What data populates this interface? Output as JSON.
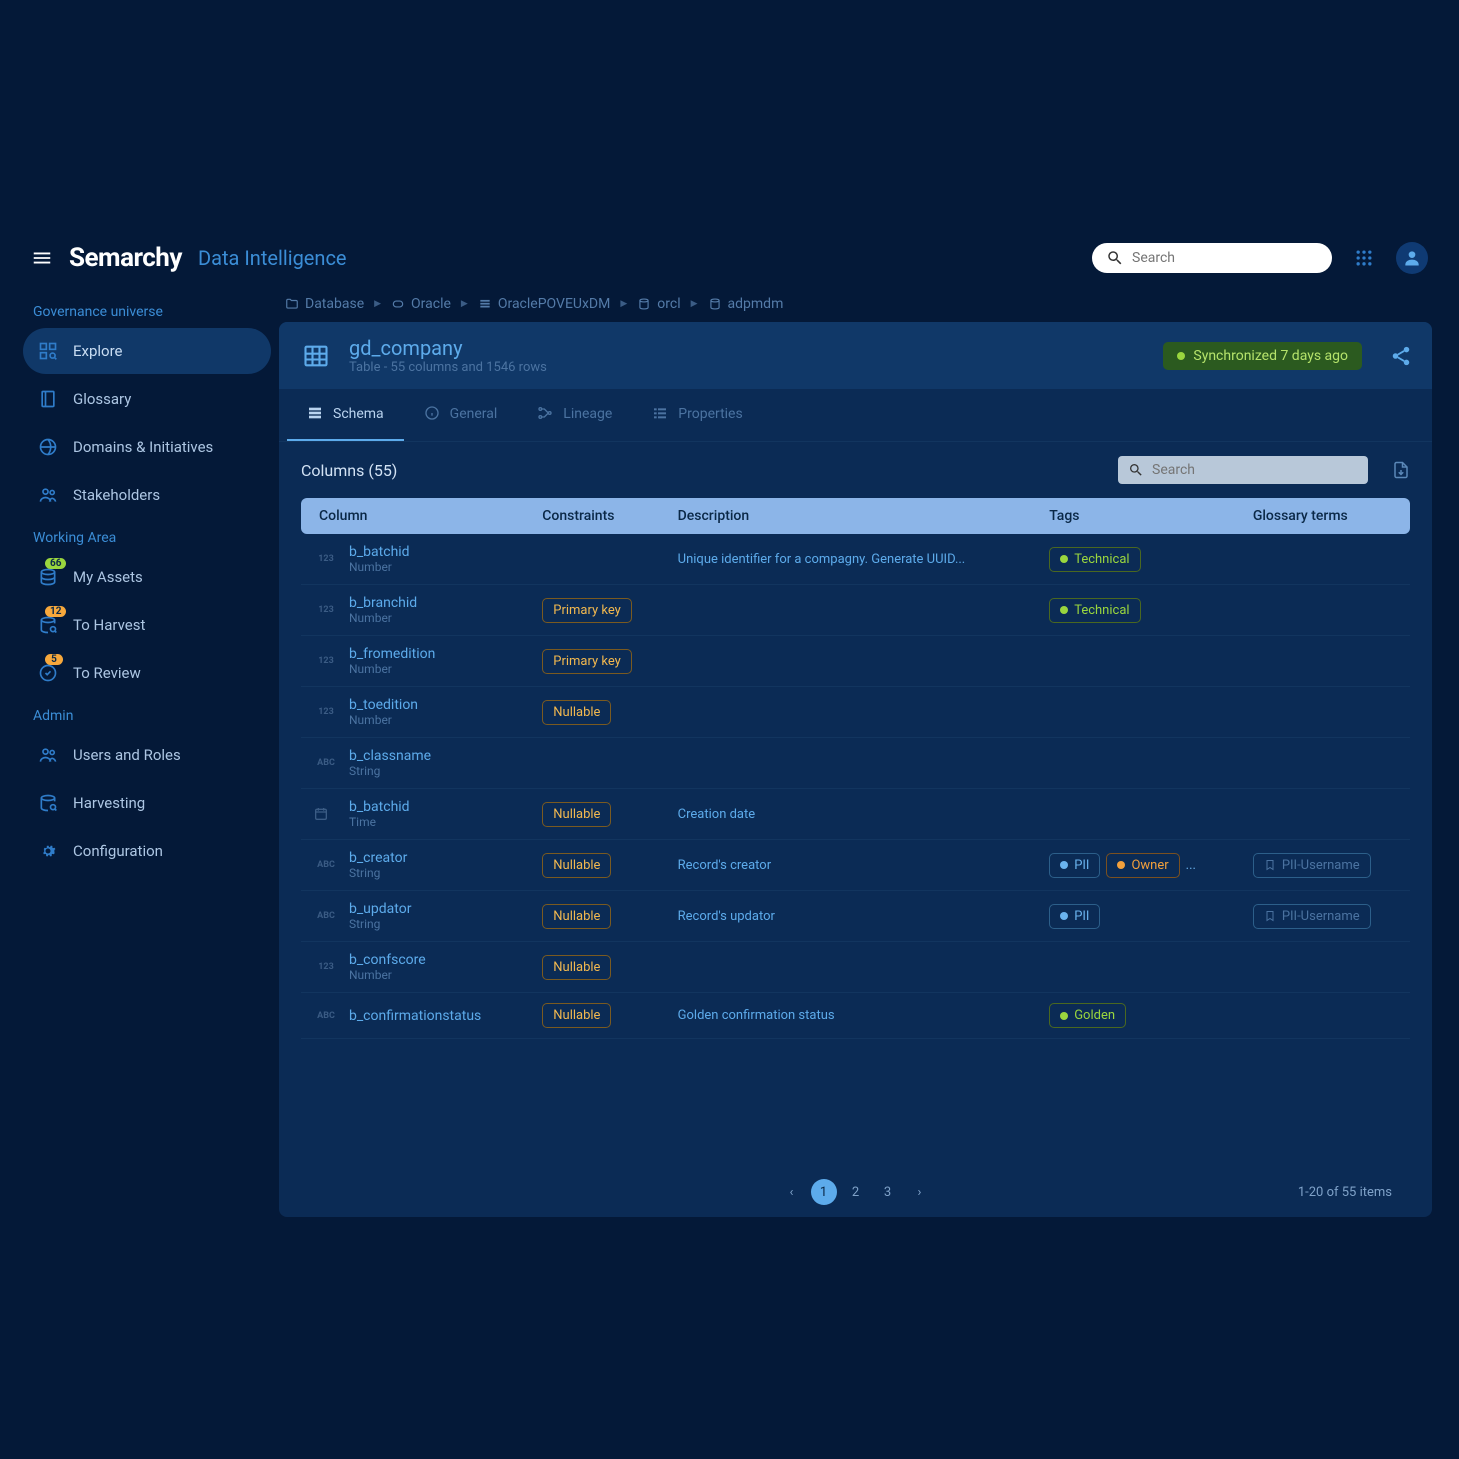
{
  "header": {
    "product": "Data Intelligence",
    "search_placeholder": "Search"
  },
  "sidebar": {
    "sections": [
      {
        "heading": "Governance universe",
        "items": [
          {
            "label": "Explore",
            "icon": "explore",
            "active": true
          },
          {
            "label": "Glossary",
            "icon": "glossary"
          },
          {
            "label": "Domains & Initiatives",
            "icon": "domains"
          },
          {
            "label": "Stakeholders",
            "icon": "stakeholders"
          }
        ]
      },
      {
        "heading": "Working Area",
        "items": [
          {
            "label": "My Assets",
            "icon": "assets",
            "badge": "66",
            "badge_color": "green"
          },
          {
            "label": "To Harvest",
            "icon": "harvest",
            "badge": "12",
            "badge_color": "orange"
          },
          {
            "label": "To Review",
            "icon": "review",
            "badge": "5",
            "badge_color": "orange"
          }
        ]
      },
      {
        "heading": "Admin",
        "items": [
          {
            "label": "Users and Roles",
            "icon": "users"
          },
          {
            "label": "Harvesting",
            "icon": "harvesting"
          },
          {
            "label": "Configuration",
            "icon": "config"
          }
        ]
      }
    ]
  },
  "breadcrumb": [
    {
      "label": "Database",
      "icon": "folder"
    },
    {
      "label": "Oracle",
      "icon": "oracle"
    },
    {
      "label": "OraclePOVEUxDM",
      "icon": "stack"
    },
    {
      "label": "orcl",
      "icon": "db"
    },
    {
      "label": "adpmdm",
      "icon": "db"
    }
  ],
  "asset": {
    "title": "gd_company",
    "subtitle": "Table - 55 columns and 1546 rows",
    "sync": "Synchronized 7 days ago"
  },
  "tabs": [
    {
      "label": "Schema",
      "icon": "schema",
      "active": true
    },
    {
      "label": "General",
      "icon": "info"
    },
    {
      "label": "Lineage",
      "icon": "lineage"
    },
    {
      "label": "Properties",
      "icon": "props"
    }
  ],
  "columns_section": {
    "title": "Columns (55)",
    "search_placeholder": "Search"
  },
  "table": {
    "headers": [
      "Column",
      "Constraints",
      "Description",
      "Tags",
      "Glossary terms"
    ],
    "rows": [
      {
        "name": "b_batchid",
        "type": "Number",
        "type_icon": "123",
        "constraints": [],
        "description": "Unique identifier for a compagny. Generate UUID...",
        "tags": [
          {
            "text": "Technical",
            "style": "green"
          }
        ],
        "glossary": []
      },
      {
        "name": "b_branchid",
        "type": "Number",
        "type_icon": "123",
        "constraints": [
          {
            "text": "Primary key",
            "style": "yellow"
          }
        ],
        "description": "",
        "tags": [
          {
            "text": "Technical",
            "style": "green"
          }
        ],
        "glossary": []
      },
      {
        "name": "b_fromedition",
        "type": "Number",
        "type_icon": "123",
        "constraints": [
          {
            "text": "Primary key",
            "style": "yellow"
          }
        ],
        "description": "",
        "tags": [],
        "glossary": []
      },
      {
        "name": "b_toedition",
        "type": "Number",
        "type_icon": "123",
        "constraints": [
          {
            "text": "Nullable",
            "style": "yellow"
          }
        ],
        "description": "",
        "tags": [],
        "glossary": []
      },
      {
        "name": "b_classname",
        "type": "String",
        "type_icon": "ABC",
        "constraints": [],
        "description": "",
        "tags": [],
        "glossary": []
      },
      {
        "name": "b_batchid",
        "type": "Time",
        "type_icon": "TIME",
        "constraints": [
          {
            "text": "Nullable",
            "style": "yellow"
          }
        ],
        "description": "Creation date",
        "tags": [],
        "glossary": []
      },
      {
        "name": "b_creator",
        "type": "String",
        "type_icon": "ABC",
        "constraints": [
          {
            "text": "Nullable",
            "style": "yellow"
          }
        ],
        "description": "Record's creator",
        "tags": [
          {
            "text": "PII",
            "style": "blue"
          },
          {
            "text": "Owner",
            "style": "orange"
          }
        ],
        "more_tags": true,
        "glossary": [
          "PII-Username"
        ]
      },
      {
        "name": "b_updator",
        "type": "String",
        "type_icon": "ABC",
        "constraints": [
          {
            "text": "Nullable",
            "style": "yellow"
          }
        ],
        "description": "Record's updator",
        "tags": [
          {
            "text": "PII",
            "style": "blue"
          }
        ],
        "glossary": [
          "PII-Username"
        ]
      },
      {
        "name": "b_confscore",
        "type": "Number",
        "type_icon": "123",
        "constraints": [
          {
            "text": "Nullable",
            "style": "yellow"
          }
        ],
        "description": "",
        "tags": [],
        "glossary": []
      },
      {
        "name": "b_confirmationstatus",
        "type": "",
        "type_icon": "ABC",
        "constraints": [
          {
            "text": "Nullable",
            "style": "yellow"
          }
        ],
        "description": "Golden confirmation status",
        "tags": [
          {
            "text": "Golden",
            "style": "green"
          }
        ],
        "glossary": []
      }
    ]
  },
  "pager": {
    "pages": [
      "1",
      "2",
      "3"
    ],
    "active": 0,
    "info": "1-20 of 55 items"
  }
}
